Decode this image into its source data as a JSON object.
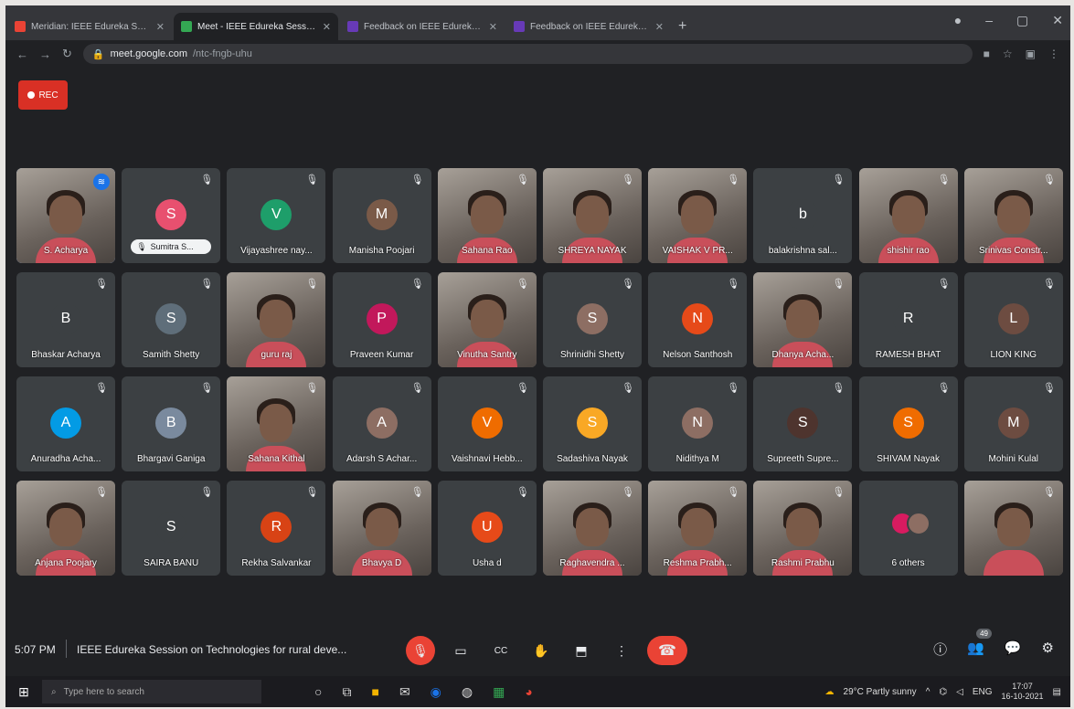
{
  "browser": {
    "tabs": [
      {
        "label": "Meridian: IEEE Edureka Session",
        "active": false,
        "favicon_color": "#ea4335"
      },
      {
        "label": "Meet - IEEE Edureka Session",
        "active": true,
        "favicon_color": "#34a853"
      },
      {
        "label": "Feedback on IEEE Edureka Session",
        "active": false,
        "favicon_color": "#673ab7"
      },
      {
        "label": "Feedback on IEEE Edureka Session",
        "active": false,
        "favicon_color": "#673ab7"
      }
    ],
    "new_tab": "+",
    "url_main": "meet.google.com",
    "url_rest": "/ntc-fngb-uhu"
  },
  "rec_label": "REC",
  "participants": [
    {
      "name": "S. Acharya",
      "type": "video",
      "active": true
    },
    {
      "name": "",
      "type": "avatar",
      "initial": "S",
      "color": "#e8506f",
      "pill": "Sumitra S..."
    },
    {
      "name": "Vijayashree nay...",
      "type": "avatar",
      "initial": "V",
      "color": "#1e9e6a"
    },
    {
      "name": "Manisha Poojari",
      "type": "avatar",
      "initial": "M",
      "color": "#7a5a48"
    },
    {
      "name": "Sahana Rao",
      "type": "video"
    },
    {
      "name": "SHREYA NAYAK",
      "type": "video"
    },
    {
      "name": "VAISHAK V PR...",
      "type": "video"
    },
    {
      "name": "balakrishna sal...",
      "type": "avatar",
      "initial": "b",
      "color": "#3c4043"
    },
    {
      "name": "shishir rao",
      "type": "video"
    },
    {
      "name": "Srinivas Constr...",
      "type": "video"
    },
    {
      "name": "Bhaskar Acharya",
      "type": "avatar",
      "initial": "B",
      "color": "#3c4043"
    },
    {
      "name": "Samith Shetty",
      "type": "avatar",
      "initial": "S",
      "color": "#5f6e7a"
    },
    {
      "name": "guru raj",
      "type": "video"
    },
    {
      "name": "Praveen Kumar",
      "type": "avatar",
      "initial": "P",
      "color": "#c2185b"
    },
    {
      "name": "Vinutha Santry",
      "type": "video"
    },
    {
      "name": "Shrinidhi Shetty",
      "type": "avatar",
      "initial": "S",
      "color": "#8d6e63"
    },
    {
      "name": "Nelson Santhosh",
      "type": "avatar",
      "initial": "N",
      "color": "#e64a19"
    },
    {
      "name": "Dhanya Acha...",
      "type": "video"
    },
    {
      "name": "RAMESH BHAT",
      "type": "avatar",
      "initial": "R",
      "color": "#3c4043"
    },
    {
      "name": "LION KING",
      "type": "avatar",
      "initial": "L",
      "color": "#6d4c41"
    },
    {
      "name": "Anuradha Acha...",
      "type": "avatar",
      "initial": "A",
      "color": "#039be5"
    },
    {
      "name": "Bhargavi Ganiga",
      "type": "avatar",
      "initial": "B",
      "color": "#7a8a9e"
    },
    {
      "name": "Sahana Kithal",
      "type": "video"
    },
    {
      "name": "Adarsh S Achar...",
      "type": "avatar",
      "initial": "A",
      "color": "#8d6e63"
    },
    {
      "name": "Vaishnavi Hebb...",
      "type": "avatar",
      "initial": "V",
      "color": "#ef6c00"
    },
    {
      "name": "Sadashiva Nayak",
      "type": "avatar",
      "initial": "S",
      "color": "#f9a825"
    },
    {
      "name": "Nidithya M",
      "type": "avatar",
      "initial": "N",
      "color": "#8d6e63"
    },
    {
      "name": "Supreeth Supre...",
      "type": "avatar",
      "initial": "S",
      "color": "#4e342e"
    },
    {
      "name": "SHIVAM Nayak",
      "type": "avatar",
      "initial": "S",
      "color": "#ef6c00"
    },
    {
      "name": "Mohini Kulal",
      "type": "avatar",
      "initial": "M",
      "color": "#6d4c41"
    },
    {
      "name": "Anjana Poojary",
      "type": "video"
    },
    {
      "name": "SAIRA BANU",
      "type": "avatar",
      "initial": "S",
      "color": "#3c4043"
    },
    {
      "name": "Rekha Salvankar",
      "type": "avatar",
      "initial": "R",
      "color": "#d84315"
    },
    {
      "name": "Bhavya D",
      "type": "video"
    },
    {
      "name": "Usha d",
      "type": "avatar",
      "initial": "U",
      "color": "#e64a19"
    },
    {
      "name": "Raghavendra ...",
      "type": "video"
    },
    {
      "name": "Reshma Prabh...",
      "type": "video"
    },
    {
      "name": "Rashmi Prabhu",
      "type": "video"
    },
    {
      "name": "6 others",
      "type": "others"
    },
    {
      "name": "",
      "type": "video"
    }
  ],
  "meeting": {
    "time": "5:07 PM",
    "title": "IEEE Edureka Session on Technologies for rural deve...",
    "people_count": "49"
  },
  "controls": {
    "mic": "🎙",
    "camera": "▭",
    "captions": "CC",
    "raise_hand": "✋",
    "present": "⬒",
    "more": "⋮",
    "end_call": "☎"
  },
  "right_controls": {
    "info": "ⓘ",
    "people": "👥",
    "chat": "💬",
    "activities": "⚙"
  },
  "taskbar": {
    "search_placeholder": "Type here to search",
    "weather": "29°C  Partly sunny",
    "lang": "ENG",
    "time": "17:07",
    "date": "16-10-2021"
  }
}
